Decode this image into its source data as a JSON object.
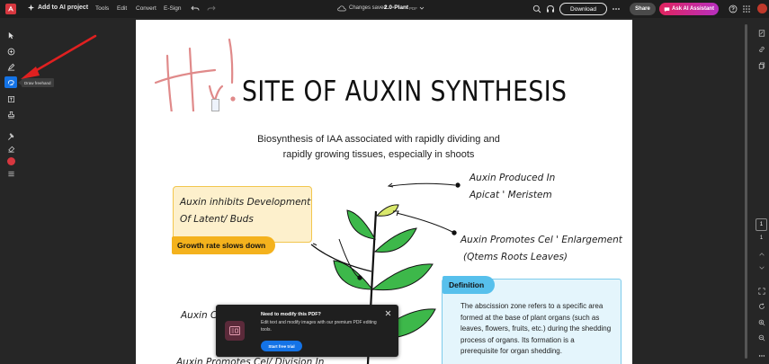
{
  "topbar": {
    "add_ai_project": "Add to AI project",
    "menu": [
      "Tools",
      "Edit",
      "Convert",
      "E-Sign"
    ],
    "status": "Changes saved",
    "file_name": "2.0-Plant",
    "file_type": "PDF",
    "download_label": "Download",
    "share_label": "Share",
    "ai_assistant_label": "Ask AI Assistant"
  },
  "tooltip": {
    "draw_freehand": "Draw freehand"
  },
  "document": {
    "handwritten_greeting": "Hi!",
    "title": "SITE OF AUXIN SYNTHESIS",
    "subtitle_line1": "Biosynthesis of IAA associated with rapidly dividing and",
    "subtitle_line2": "rapidly growing tissues, especially in shoots",
    "note_produced_1": "Auxin Produced In",
    "note_produced_2": "Apicat ' Meristem",
    "note_inhibits_1": "Auxin inhibits Development",
    "note_inhibits_2": "Of Latent/ Buds",
    "badge_growth": "Growth rate slows down",
    "note_promotes_1": "Auxin Promotes Cel ' Enlargement",
    "note_promotes_2": "(Qtems Roots Leaves)",
    "badge_definition": "Definition",
    "definition_text": "The abscission zone refers to a specific area formed at the base of plant organs (such as leaves, flowers, fruits, etc.) during the shedding process of organs. Its formation is a prerequisite for organ shedding.",
    "note_partial_1": "Auxin Co",
    "note_partial_2": "Auxin Promotes Cel/ Division In"
  },
  "promo": {
    "title": "Need to modify this PDF?",
    "text": "Edit text and modify images with our premium PDF editing tools.",
    "button": "Start free trial"
  },
  "pager": {
    "current": "1",
    "total": "1"
  },
  "colors": {
    "accent_blue": "#1473e6",
    "ai_gradient_start": "#e0245e",
    "ai_gradient_end": "#b72fbf",
    "highlight_yellow": "#f4b21d",
    "highlight_blue": "#57c0ec",
    "arrow_red": "#e02020",
    "handwriting_pink": "#e08a8a"
  }
}
